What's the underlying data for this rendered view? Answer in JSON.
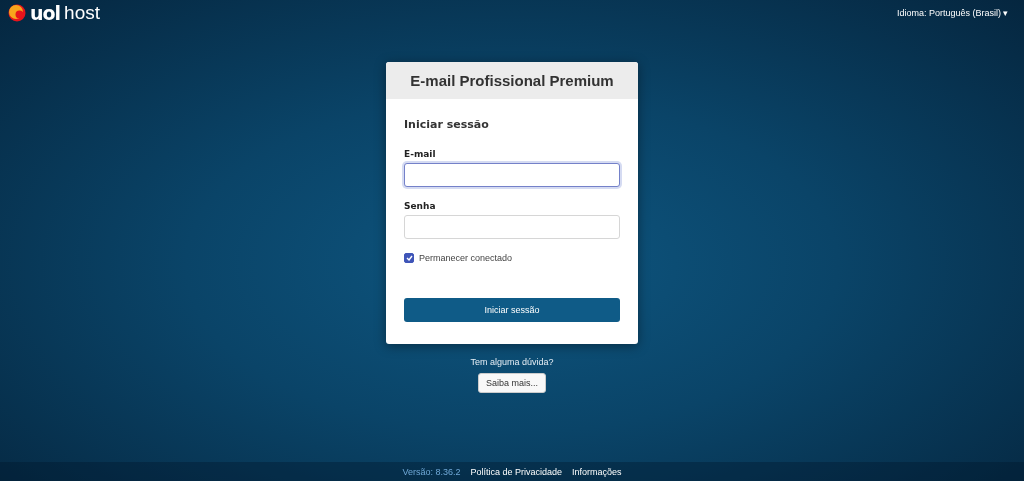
{
  "header": {
    "logo": {
      "brand": "uol",
      "product": "host"
    },
    "language": {
      "label": "Idioma: Português (Brasil)",
      "caret": "▾"
    }
  },
  "login": {
    "title": "E-mail Profissional Premium",
    "heading": "Iniciar sessão",
    "fields": [
      {
        "label": "E-mail",
        "focused": true
      },
      {
        "label": "Senha",
        "focused": false
      }
    ],
    "remember": {
      "label": "Permanecer conectado",
      "checked": true
    },
    "submit": "Iniciar sessão"
  },
  "help": {
    "question": "Tem alguma dúvida?",
    "button": "Saiba mais..."
  },
  "footer": {
    "version": "Versão: 8.36.2",
    "links": [
      "Política de Privacidade",
      "Informações"
    ]
  }
}
